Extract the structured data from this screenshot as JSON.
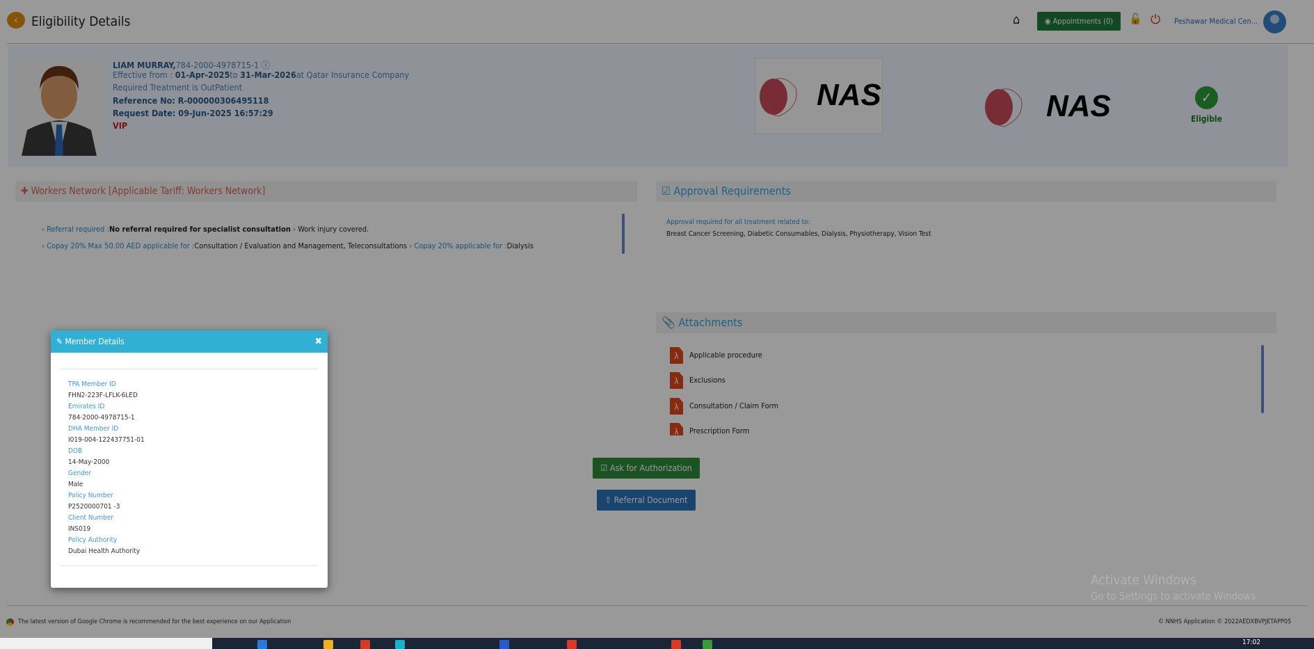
{
  "header": {
    "title": "Eligibility Details",
    "appointments_label": "Appointments (0)",
    "clinic": "Peshawar Medical Cen..."
  },
  "patient": {
    "name": "LIAM MURRAY,",
    "id": "784-2000-4978715-1",
    "effective_prefix": "Effective from : ",
    "from": "01-Apr-2025",
    "to_word": "to ",
    "to": "31-Mar-2026",
    "insurer": "at Qatar Insurance Company",
    "treatment": "Required Treatment is OutPatient",
    "reference": "Reference No: R-000000306495118",
    "request_date": "Request Date: 09-Jun-2025 16:57:29",
    "vip": "VIP"
  },
  "logos": {
    "payer_logo_text": "NAS",
    "insurer_logo_text": "NAS"
  },
  "eligibility": {
    "status": "Eligible",
    "color": "#2e9a3a"
  },
  "network": {
    "title": "Workers Network [Applicable Tariff: Workers Network]",
    "lines": [
      [
        {
          "label": "Referral required :",
          "value": "No referral required for specialist consultation",
          "bold": true
        },
        {
          "label": "",
          "value": "Work injury covered."
        }
      ],
      [
        {
          "label": "Copay 20% Max 50.00 AED applicable for :",
          "value": "Consultation / Evaluation and Management, Teleconsultations"
        },
        {
          "label": "Copay 20% applicable for :",
          "value": "Dialysis"
        }
      ]
    ]
  },
  "approval": {
    "title": "Approval Requirements",
    "label": "Approval required for all treatment related to:",
    "value": "Breast Cancer Screening, Diabetic Consumables, Dialysis, Physiotherapy, Vision Test"
  },
  "attachments": {
    "title": "Attachments",
    "items": [
      "Applicable procedure",
      "Exclusions",
      "Consultation / Claim Form",
      "Prescription Form"
    ]
  },
  "actions": {
    "authorization": "Ask for Authorization",
    "referral": "Referral Document"
  },
  "modal": {
    "title": "Member Details",
    "fields": [
      {
        "label": "TPA Member ID",
        "value": "FHN2-223F-LFLK-6LED"
      },
      {
        "label": "Emirates ID",
        "value": "784-2000-4978715-1"
      },
      {
        "label": "DHA Member ID",
        "value": "I019-004-122437751-01"
      },
      {
        "label": "DOB",
        "value": "14-May-2000"
      },
      {
        "label": "Gender",
        "value": "Male"
      },
      {
        "label": "Policy Number",
        "value": "P2520000701 -3"
      },
      {
        "label": "Client Number",
        "value": "INS019"
      },
      {
        "label": "Policy Authority",
        "value": "Dubai Health Authority"
      }
    ]
  },
  "footer": {
    "browser_note": "The latest version of Google Chrome is recommended for the best experience on our Application",
    "copyright": "NNHS Application © 2022AEDXBVPJETAPP05"
  },
  "watermark": {
    "line1": "Activate Windows",
    "line2": "Go to Settings to activate Windows"
  },
  "taskbar": {
    "time": "17:02"
  }
}
